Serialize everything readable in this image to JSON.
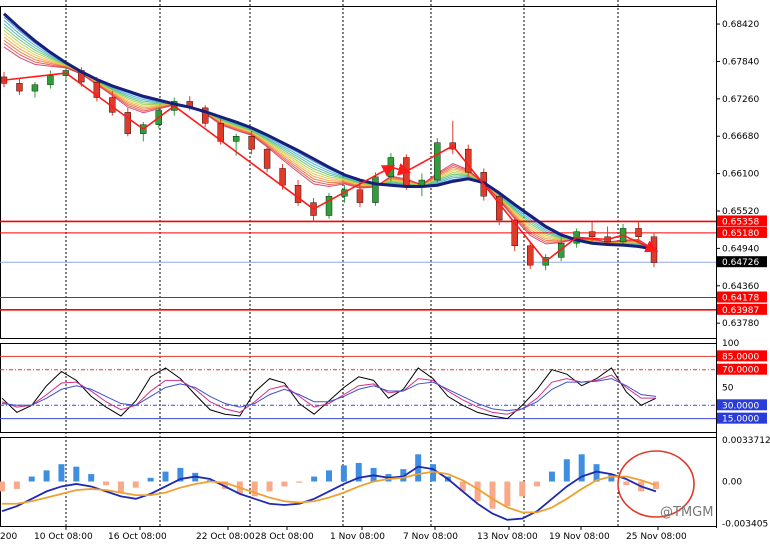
{
  "chart_data": [
    {
      "type": "candlestick",
      "panel": "price",
      "y_ticks": [
        "0.68420",
        "0.67840",
        "0.67260",
        "0.66680",
        "0.66100",
        "0.65520",
        "0.64940",
        "0.64360",
        "0.63780"
      ],
      "ylim": [
        0.6355,
        0.687
      ],
      "current_price": "0.64726",
      "red_levels": [
        {
          "label": "0.65358",
          "value": 0.65358
        },
        {
          "label": "0.65180",
          "value": 0.6518
        },
        {
          "label": "0.64178",
          "value": 0.64178
        },
        {
          "label": "0.63987",
          "value": 0.63987
        }
      ],
      "colors": {
        "bull": "#2f9e3a",
        "bear": "#e03a2a",
        "ma_main": "#16207a",
        "levels": "#ff0000",
        "current": "#8fa8e8"
      },
      "candles": [
        {
          "t": 0,
          "o": 0.676,
          "h": 0.6768,
          "l": 0.6744,
          "c": 0.675
        },
        {
          "t": 1,
          "o": 0.675,
          "h": 0.6758,
          "l": 0.6732,
          "c": 0.6738
        },
        {
          "t": 2,
          "o": 0.6738,
          "h": 0.6752,
          "l": 0.6728,
          "c": 0.6748
        },
        {
          "t": 3,
          "o": 0.6748,
          "h": 0.677,
          "l": 0.6742,
          "c": 0.6762
        },
        {
          "t": 4,
          "o": 0.6762,
          "h": 0.6776,
          "l": 0.6755,
          "c": 0.677
        },
        {
          "t": 5,
          "o": 0.677,
          "h": 0.6775,
          "l": 0.6745,
          "c": 0.6752
        },
        {
          "t": 6,
          "o": 0.6752,
          "h": 0.676,
          "l": 0.6722,
          "c": 0.6728
        },
        {
          "t": 7,
          "o": 0.6728,
          "h": 0.6738,
          "l": 0.67,
          "c": 0.6705
        },
        {
          "t": 8,
          "o": 0.6705,
          "h": 0.6712,
          "l": 0.6668,
          "c": 0.6672
        },
        {
          "t": 9,
          "o": 0.6672,
          "h": 0.669,
          "l": 0.666,
          "c": 0.6686
        },
        {
          "t": 10,
          "o": 0.6686,
          "h": 0.6712,
          "l": 0.668,
          "c": 0.6708
        },
        {
          "t": 11,
          "o": 0.6708,
          "h": 0.6728,
          "l": 0.67,
          "c": 0.6722
        },
        {
          "t": 12,
          "o": 0.6722,
          "h": 0.673,
          "l": 0.6708,
          "c": 0.6712
        },
        {
          "t": 13,
          "o": 0.6712,
          "h": 0.6716,
          "l": 0.6682,
          "c": 0.6688
        },
        {
          "t": 14,
          "o": 0.6688,
          "h": 0.6695,
          "l": 0.6655,
          "c": 0.666
        },
        {
          "t": 15,
          "o": 0.666,
          "h": 0.6672,
          "l": 0.6638,
          "c": 0.6668
        },
        {
          "t": 16,
          "o": 0.6668,
          "h": 0.6676,
          "l": 0.664,
          "c": 0.6648
        },
        {
          "t": 17,
          "o": 0.6648,
          "h": 0.6652,
          "l": 0.6612,
          "c": 0.6618
        },
        {
          "t": 18,
          "o": 0.6618,
          "h": 0.6625,
          "l": 0.6585,
          "c": 0.6592
        },
        {
          "t": 19,
          "o": 0.6592,
          "h": 0.66,
          "l": 0.656,
          "c": 0.6565
        },
        {
          "t": 20,
          "o": 0.6565,
          "h": 0.6572,
          "l": 0.6535,
          "c": 0.6545
        },
        {
          "t": 21,
          "o": 0.6545,
          "h": 0.658,
          "l": 0.654,
          "c": 0.6575
        },
        {
          "t": 22,
          "o": 0.6575,
          "h": 0.6592,
          "l": 0.6565,
          "c": 0.6585
        },
        {
          "t": 23,
          "o": 0.6585,
          "h": 0.66,
          "l": 0.6558,
          "c": 0.6565
        },
        {
          "t": 24,
          "o": 0.6565,
          "h": 0.6612,
          "l": 0.656,
          "c": 0.6605
        },
        {
          "t": 25,
          "o": 0.6605,
          "h": 0.6642,
          "l": 0.6598,
          "c": 0.6635
        },
        {
          "t": 26,
          "o": 0.6635,
          "h": 0.664,
          "l": 0.6585,
          "c": 0.6592
        },
        {
          "t": 27,
          "o": 0.6592,
          "h": 0.661,
          "l": 0.6575,
          "c": 0.66
        },
        {
          "t": 28,
          "o": 0.66,
          "h": 0.6665,
          "l": 0.6596,
          "c": 0.6658
        },
        {
          "t": 29,
          "o": 0.6658,
          "h": 0.6692,
          "l": 0.664,
          "c": 0.6648
        },
        {
          "t": 30,
          "o": 0.6648,
          "h": 0.6655,
          "l": 0.6605,
          "c": 0.6612
        },
        {
          "t": 31,
          "o": 0.6612,
          "h": 0.6618,
          "l": 0.6568,
          "c": 0.6575
        },
        {
          "t": 32,
          "o": 0.6575,
          "h": 0.658,
          "l": 0.653,
          "c": 0.6538
        },
        {
          "t": 33,
          "o": 0.6538,
          "h": 0.6542,
          "l": 0.649,
          "c": 0.6498
        },
        {
          "t": 34,
          "o": 0.6498,
          "h": 0.6505,
          "l": 0.6462,
          "c": 0.6468
        },
        {
          "t": 35,
          "o": 0.6468,
          "h": 0.6485,
          "l": 0.646,
          "c": 0.648
        },
        {
          "t": 36,
          "o": 0.648,
          "h": 0.651,
          "l": 0.6474,
          "c": 0.6502
        },
        {
          "t": 37,
          "o": 0.6502,
          "h": 0.6525,
          "l": 0.6495,
          "c": 0.652
        },
        {
          "t": 38,
          "o": 0.652,
          "h": 0.6535,
          "l": 0.6505,
          "c": 0.6512
        },
        {
          "t": 39,
          "o": 0.6512,
          "h": 0.6528,
          "l": 0.6498,
          "c": 0.6504
        },
        {
          "t": 40,
          "o": 0.6504,
          "h": 0.6532,
          "l": 0.65,
          "c": 0.6525
        },
        {
          "t": 41,
          "o": 0.6525,
          "h": 0.6535,
          "l": 0.6505,
          "c": 0.6512
        },
        {
          "t": 42,
          "o": 0.6512,
          "h": 0.6518,
          "l": 0.6465,
          "c": 0.6472
        }
      ],
      "ma_main": [
        0.6858,
        0.6836,
        0.6816,
        0.6798,
        0.6782,
        0.6768,
        0.6756,
        0.6746,
        0.6738,
        0.673,
        0.6724,
        0.6718,
        0.6713,
        0.6706,
        0.6698,
        0.669,
        0.6681,
        0.667,
        0.6658,
        0.6646,
        0.6633,
        0.662,
        0.6608,
        0.66,
        0.6594,
        0.6592,
        0.659,
        0.659,
        0.6592,
        0.6598,
        0.6602,
        0.6596,
        0.658,
        0.6562,
        0.6545,
        0.6528,
        0.6515,
        0.6507,
        0.6502,
        0.65,
        0.6499,
        0.6497,
        0.6493
      ]
    },
    {
      "type": "line",
      "panel": "stochastic",
      "y_ticks": [
        "100",
        "50"
      ],
      "ylim": [
        0,
        100
      ],
      "levels": [
        {
          "label": "85.0000",
          "value": 85
        },
        {
          "label": "70.0000",
          "value": 70
        },
        {
          "label": "30.0000",
          "value": 30
        },
        {
          "label": "15.0000",
          "value": 15
        }
      ],
      "series": [
        {
          "color": "#000000",
          "values": [
            38,
            22,
            30,
            52,
            68,
            58,
            40,
            28,
            18,
            35,
            62,
            72,
            60,
            42,
            25,
            20,
            18,
            45,
            60,
            55,
            32,
            20,
            35,
            50,
            62,
            58,
            38,
            48,
            72,
            60,
            40,
            30,
            22,
            18,
            15,
            30,
            48,
            70,
            65,
            52,
            60,
            72,
            45,
            30,
            38
          ]
        },
        {
          "color": "#d0308a",
          "values": [
            34,
            28,
            30,
            42,
            55,
            56,
            46,
            34,
            25,
            30,
            46,
            58,
            58,
            48,
            34,
            26,
            22,
            34,
            48,
            52,
            40,
            28,
            32,
            42,
            52,
            54,
            44,
            46,
            60,
            58,
            46,
            36,
            28,
            22,
            20,
            26,
            38,
            56,
            60,
            56,
            58,
            64,
            50,
            38,
            38
          ]
        },
        {
          "color": "#4050d0",
          "values": [
            32,
            30,
            30,
            38,
            48,
            52,
            48,
            40,
            32,
            30,
            40,
            50,
            54,
            50,
            40,
            32,
            28,
            32,
            42,
            48,
            42,
            34,
            34,
            40,
            48,
            52,
            46,
            46,
            54,
            56,
            48,
            40,
            32,
            26,
            24,
            26,
            34,
            48,
            56,
            56,
            57,
            60,
            52,
            42,
            40
          ]
        }
      ]
    },
    {
      "type": "bar+line",
      "panel": "macd",
      "y_ticks": [
        "0.0033712",
        "0.00",
        "-0.003405"
      ],
      "ylim": [
        -0.0036,
        0.0036
      ],
      "histogram": [
        -0.0008,
        -0.0006,
        0.0004,
        0.0009,
        0.0014,
        0.0012,
        0.0006,
        -0.0003,
        -0.0009,
        -0.0005,
        0.0003,
        0.0008,
        0.0011,
        0.0007,
        0.0001,
        -0.0006,
        -0.001,
        -0.0012,
        -0.0008,
        -0.0004,
        -0.0001,
        0.0004,
        0.0009,
        0.0013,
        0.0015,
        0.0011,
        0.0006,
        0.001,
        0.0022,
        0.0014,
        0.0004,
        -0.0008,
        -0.0016,
        -0.0022,
        -0.002,
        -0.0012,
        -0.0004,
        0.0008,
        0.0018,
        0.0022,
        0.0014,
        0.0006,
        -0.0003,
        -0.0008,
        -0.0006
      ],
      "series": [
        {
          "color": "#1e2ab0",
          "values": [
            -0.0024,
            -0.002,
            -0.0014,
            -0.0008,
            -0.0004,
            -0.0002,
            -0.0004,
            -0.0008,
            -0.0012,
            -0.0014,
            -0.001,
            -0.0004,
            0.0002,
            0.0004,
            0.0002,
            -0.0004,
            -0.001,
            -0.0014,
            -0.0018,
            -0.0019,
            -0.0018,
            -0.0014,
            -0.0008,
            -0.0002,
            0.0003,
            0.0005,
            0.0003,
            0.0004,
            0.0012,
            0.001,
            0.0002,
            -0.0008,
            -0.0018,
            -0.0026,
            -0.0031,
            -0.003,
            -0.0024,
            -0.0014,
            -0.0004,
            0.0004,
            0.0008,
            0.0006,
            0.0002,
            -0.0004,
            -0.0008
          ]
        },
        {
          "color": "#f0a030",
          "values": [
            -0.0018,
            -0.0018,
            -0.0016,
            -0.0013,
            -0.001,
            -0.0007,
            -0.0006,
            -0.0007,
            -0.0009,
            -0.0011,
            -0.0011,
            -0.0009,
            -0.0005,
            -0.0002,
            0.0,
            -0.0001,
            -0.0005,
            -0.0009,
            -0.0013,
            -0.0016,
            -0.0017,
            -0.0016,
            -0.0013,
            -0.0009,
            -0.0004,
            0.0,
            0.0002,
            0.0003,
            0.0006,
            0.0008,
            0.0006,
            0.0001,
            -0.0006,
            -0.0014,
            -0.0021,
            -0.0025,
            -0.0025,
            -0.0021,
            -0.0014,
            -0.0006,
            0.0001,
            0.0004,
            0.0004,
            0.0001,
            -0.0003
          ]
        }
      ]
    }
  ],
  "x_labels": [
    "10 Oct 08:00",
    "16 Oct 08:00",
    "22 Oct 08:00",
    "28 Oct 08:00",
    "1 Nov 08:00",
    "7 Nov 08:00",
    "13 Nov 08:00",
    "19 Nov 08:00",
    "25 Nov 08:00"
  ],
  "x_label_partial": "200",
  "watermark": "@TMGM"
}
